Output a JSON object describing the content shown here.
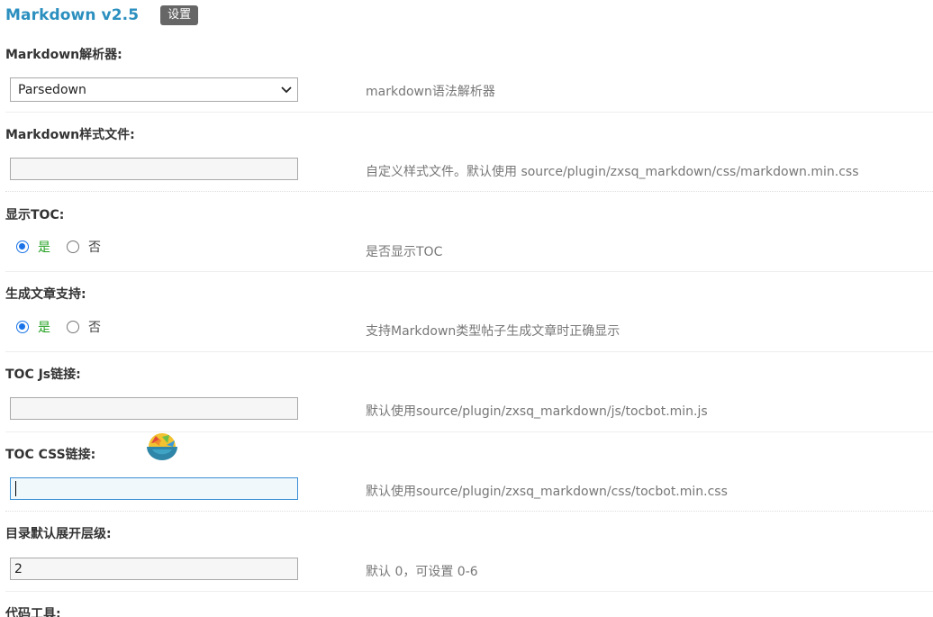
{
  "header": {
    "title": "Markdown v2.5",
    "badge": "设置"
  },
  "sections": {
    "parser": {
      "label": "Markdown解析器:",
      "selected": "Parsedown",
      "help": "markdown语法解析器"
    },
    "style_file": {
      "label": "Markdown样式文件:",
      "value": "",
      "help": "自定义样式文件。默认使用 source/plugin/zxsq_markdown/css/markdown.min.css"
    },
    "show_toc": {
      "label": "显示TOC:",
      "yes": "是",
      "no": "否",
      "selected": "yes",
      "help": "是否显示TOC"
    },
    "article_support": {
      "label": "生成文章支持:",
      "yes": "是",
      "no": "否",
      "selected": "yes",
      "help": "支持Markdown类型帖子生成文章时正确显示"
    },
    "toc_js": {
      "label": "TOC Js链接:",
      "value": "",
      "help": "默认使用source/plugin/zxsq_markdown/js/tocbot.min.js"
    },
    "toc_css": {
      "label": "TOC CSS链接:",
      "value": "",
      "help": "默认使用source/plugin/zxsq_markdown/css/tocbot.min.css"
    },
    "toc_level": {
      "label": "目录默认展开层级:",
      "value": "2",
      "help": "默认 0，可设置 0-6"
    },
    "code_tools": {
      "label": "代码工具:"
    }
  },
  "icons": {
    "floating": "colorful-bowl-icon",
    "select_arrow": "chevron-down-icon"
  },
  "colors": {
    "title": "#2b8fbf",
    "badge_bg": "#666666",
    "radio_checked": "#1a73e8",
    "yes_text": "#22a020",
    "help_text": "#777777"
  }
}
